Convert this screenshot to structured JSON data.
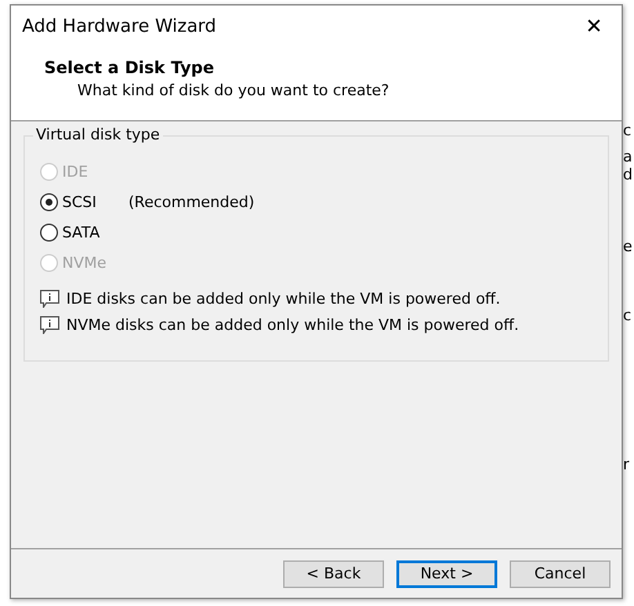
{
  "background_fragments": [
    "c",
    "a",
    "d",
    "e",
    "c",
    "r"
  ],
  "window": {
    "title": "Add Hardware Wizard",
    "close": "✕"
  },
  "header": {
    "title": "Select a Disk Type",
    "subtitle": "What kind of disk do you want to create?"
  },
  "group": {
    "title": "Virtual disk type",
    "options": [
      {
        "label": "IDE",
        "selected": false,
        "disabled": true
      },
      {
        "label": "SCSI",
        "note": "(Recommended)",
        "selected": true,
        "disabled": false
      },
      {
        "label": "SATA",
        "selected": false,
        "disabled": false
      },
      {
        "label": "NVMe",
        "selected": false,
        "disabled": true
      }
    ],
    "notes": [
      "IDE disks can be added only while the VM is powered off.",
      "NVMe disks can be added only while the VM is powered off."
    ]
  },
  "buttons": [
    {
      "label": "< Back",
      "default": false
    },
    {
      "label": "Next >",
      "default": true
    },
    {
      "label": "Cancel",
      "default": false
    }
  ]
}
